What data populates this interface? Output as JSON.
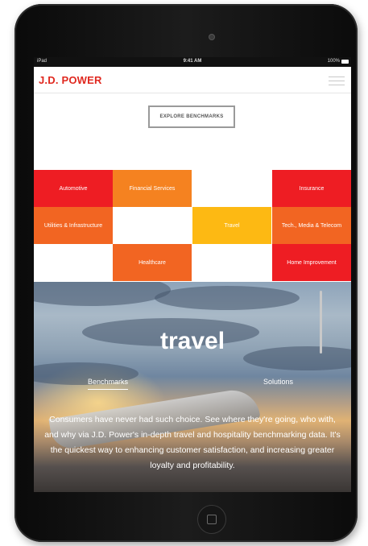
{
  "status_bar": {
    "device": "iPad",
    "time": "9:41 AM",
    "battery": "100%"
  },
  "header": {
    "logo": "J.D. POWER"
  },
  "explore_button": "EXPLORE BENCHMARKS",
  "tiles": {
    "automotive": "Automotive",
    "financial": "Financial Services",
    "insurance": "Insurance",
    "utilities": "Utilities & Infrastructure",
    "travel": "Travel",
    "telecom": "Tech., Media & Telecom",
    "healthcare": "Healthcare",
    "home": "Home Improvement"
  },
  "hero": {
    "title": "travel",
    "tabs": {
      "benchmarks": "Benchmarks",
      "solutions": "Solutions"
    },
    "body": "Consumers have never had such choice. See where they're going, who with, and why via J.D. Power's in-depth travel and hospitality benchmarking data. It's the quickest way to enhancing customer satisfaction, and increasing greater loyalty and profitability."
  },
  "colors": {
    "brand_red": "#e0281f",
    "tile_red": "#ee1d23",
    "tile_orange": "#f58220",
    "tile_yellow": "#fdb913"
  }
}
